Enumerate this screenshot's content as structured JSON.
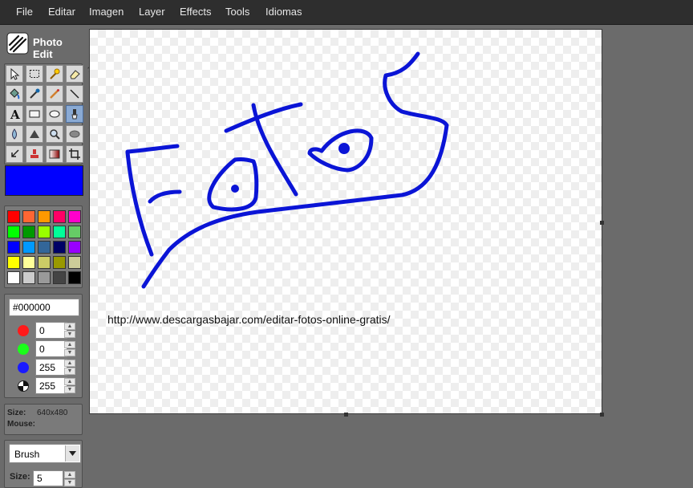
{
  "menu": [
    "File",
    "Editar",
    "Imagen",
    "Layer",
    "Effects",
    "Tools",
    "Idiomas"
  ],
  "logo": {
    "line1": "Photo",
    "line2": "Edit"
  },
  "tools": [
    {
      "icon": "pointer-icon"
    },
    {
      "icon": "rect-select-icon"
    },
    {
      "icon": "magic-wand-icon"
    },
    {
      "icon": "eraser-icon"
    },
    {
      "icon": "paint-bucket-icon"
    },
    {
      "icon": "eyedropper-icon"
    },
    {
      "icon": "pencil-icon"
    },
    {
      "icon": "line-icon"
    },
    {
      "icon": "text-icon"
    },
    {
      "icon": "rectangle-icon"
    },
    {
      "icon": "ellipse-icon"
    },
    {
      "icon": "brush-icon"
    },
    {
      "icon": "blur-icon"
    },
    {
      "icon": "sharpen-icon"
    },
    {
      "icon": "zoom-icon"
    },
    {
      "icon": "smudge-icon"
    },
    {
      "icon": "resize-icon"
    },
    {
      "icon": "clone-stamp-icon"
    },
    {
      "icon": "gradient-icon"
    },
    {
      "icon": "crop-icon"
    }
  ],
  "colors": {
    "active": "#0000ff",
    "palette": [
      "#ff0000",
      "#ff6633",
      "#ff9900",
      "#ff0066",
      "#ff00cc",
      "#00ff00",
      "#009900",
      "#99ff00",
      "#00ff99",
      "#66cc66",
      "#0000ff",
      "#0099ff",
      "#336699",
      "#000066",
      "#9900ff",
      "#ffff00",
      "#ffff99",
      "#cccc66",
      "#999900",
      "#cccc99",
      "#ffffff",
      "#cccccc",
      "#999999",
      "#444444",
      "#000000"
    ]
  },
  "color_panel": {
    "hex": "#000000",
    "r": "0",
    "g": "0",
    "b": "255",
    "alpha": "255"
  },
  "info": {
    "size_label": "Size:",
    "size_value": "640x480",
    "mouse_label": "Mouse:"
  },
  "brush_panel": {
    "tool": "Brush",
    "size_label": "Size:",
    "size_value": "5"
  },
  "canvas": {
    "url_text": "http://www.descargasbajar.com/editar-fotos-online-gratis/",
    "stroke_color": "#0a14d6"
  }
}
